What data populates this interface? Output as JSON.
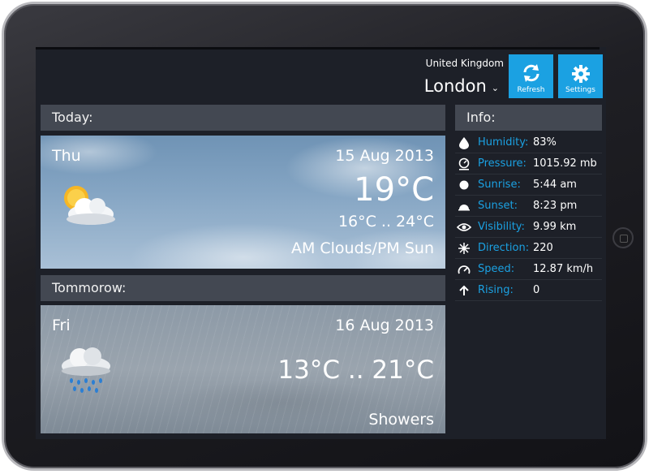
{
  "header": {
    "country": "United Kingdom",
    "city": "London",
    "refresh_label": "Refresh",
    "settings_label": "Settings"
  },
  "today": {
    "section_label": "Today:",
    "day": "Thu",
    "date": "15 Aug 2013",
    "current_temp": "19°C",
    "range": "16°C .. 24°C",
    "condition": "AM Clouds/PM Sun",
    "icon": "partly-sunny-icon"
  },
  "tomorrow": {
    "section_label": "Tommorow:",
    "day": "Fri",
    "date": "16 Aug 2013",
    "range": "13°C .. 21°C",
    "condition": "Showers",
    "icon": "rain-cloud-icon"
  },
  "info": {
    "title": "Info:",
    "rows": [
      {
        "label": "Humidity:",
        "value": "83%",
        "icon": "humidity-icon"
      },
      {
        "label": "Pressure:",
        "value": "1015.92 mb",
        "icon": "pressure-icon"
      },
      {
        "label": "Sunrise:",
        "value": "5:44 am",
        "icon": "sunrise-icon"
      },
      {
        "label": "Sunset:",
        "value": "8:23 pm",
        "icon": "sunset-icon"
      },
      {
        "label": "Visibility:",
        "value": "9.99 km",
        "icon": "visibility-icon"
      },
      {
        "label": "Direction:",
        "value": "220",
        "icon": "wind-direction-icon"
      },
      {
        "label": "Speed:",
        "value": "12.87 km/h",
        "icon": "speed-icon"
      },
      {
        "label": "Rising:",
        "value": "0",
        "icon": "rising-arrow-icon"
      }
    ]
  },
  "colors": {
    "accent": "#1ba1e2",
    "background": "#1d2028",
    "header_bar": "#434852"
  }
}
